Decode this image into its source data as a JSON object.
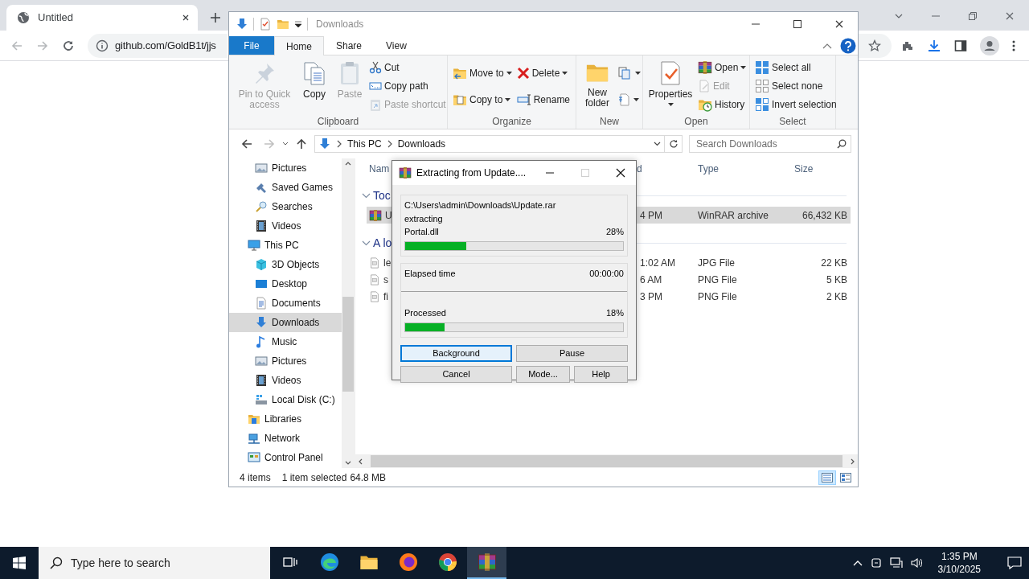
{
  "browser": {
    "tab_title": "Untitled",
    "url": "github.com/GoldB1t/jjs"
  },
  "explorer": {
    "title": "Downloads",
    "ribbon": {
      "tabs": [
        {
          "label": "File",
          "selected": false,
          "kind": "file"
        },
        {
          "label": "Home",
          "selected": true,
          "kind": "tab"
        },
        {
          "label": "Share",
          "selected": false,
          "kind": "tab"
        },
        {
          "label": "View",
          "selected": false,
          "kind": "tab"
        }
      ],
      "groups": [
        {
          "label": "Clipboard",
          "columns": [
            [
              {
                "kind": "large",
                "label": "Pin to Quick access",
                "disabled": true,
                "dropdown": false
              }
            ],
            [
              {
                "kind": "large",
                "label": "Copy",
                "disabled": false,
                "dropdown": false
              }
            ],
            [
              {
                "kind": "large",
                "label": "Paste",
                "disabled": true,
                "dropdown": false
              }
            ],
            [
              {
                "kind": "small",
                "label": "Cut",
                "disabled": false,
                "dropdown": false
              },
              {
                "kind": "small",
                "label": "Copy path",
                "disabled": false,
                "dropdown": false
              },
              {
                "kind": "small",
                "label": "Paste shortcut",
                "disabled": true,
                "dropdown": false
              }
            ]
          ]
        },
        {
          "label": "Organize",
          "columns": [
            [
              {
                "kind": "small",
                "label": "Move to",
                "disabled": false,
                "dropdown": true
              },
              {
                "kind": "small",
                "label": "Copy to",
                "disabled": false,
                "dropdown": true
              }
            ],
            [
              {
                "kind": "small",
                "label": "Delete",
                "disabled": false,
                "dropdown": true
              },
              {
                "kind": "small",
                "label": "Rename",
                "disabled": false,
                "dropdown": false
              }
            ]
          ]
        },
        {
          "label": "New",
          "columns": [
            [
              {
                "kind": "large",
                "label": "New folder",
                "disabled": false,
                "dropdown": false
              }
            ],
            [
              {
                "kind": "small",
                "disabled": false,
                "dropdown": true
              },
              {
                "kind": "small",
                "disabled": false,
                "dropdown": true
              }
            ]
          ]
        },
        {
          "label": "Open",
          "columns": [
            [
              {
                "kind": "large",
                "label": "Properties",
                "disabled": false,
                "dropdown": true
              }
            ],
            [
              {
                "kind": "small",
                "label": "Open",
                "disabled": false,
                "dropdown": true
              },
              {
                "kind": "small",
                "label": "Edit",
                "disabled": true,
                "dropdown": false
              },
              {
                "kind": "small",
                "label": "History",
                "disabled": false,
                "dropdown": false
              }
            ]
          ]
        },
        {
          "label": "Select",
          "columns": [
            [
              {
                "kind": "small",
                "label": "Select all",
                "disabled": false,
                "dropdown": false
              },
              {
                "kind": "small",
                "label": "Select none",
                "disabled": false,
                "dropdown": false
              },
              {
                "kind": "small",
                "label": "Invert selection",
                "disabled": false,
                "dropdown": false
              }
            ]
          ]
        }
      ]
    },
    "address": {
      "crumbs": [
        "This PC",
        "Downloads"
      ],
      "search_placeholder": "Search Downloads"
    },
    "nav_pane": {
      "items": [
        {
          "children": [
            {
              "label": "Pictures",
              "kind": "pictures",
              "selected": false
            },
            {
              "label": "Saved Games",
              "kind": "games",
              "selected": false
            },
            {
              "label": "Searches",
              "kind": "searches",
              "selected": false
            },
            {
              "label": "Videos",
              "kind": "videos",
              "selected": false
            }
          ]
        },
        {
          "label": "This PC",
          "kind": "pc",
          "selected": false,
          "children": [
            {
              "label": "3D Objects",
              "kind": "objects",
              "selected": false
            },
            {
              "label": "Desktop",
              "kind": "desktop",
              "selected": false
            },
            {
              "label": "Documents",
              "kind": "documents",
              "selected": false
            },
            {
              "label": "Downloads",
              "kind": "downloads",
              "selected": true
            },
            {
              "label": "Music",
              "kind": "music",
              "selected": false
            },
            {
              "label": "Pictures",
              "kind": "pictures",
              "selected": false
            },
            {
              "label": "Videos",
              "kind": "videos",
              "selected": false
            },
            {
              "label": "Local Disk (C:)",
              "kind": "drive",
              "selected": false
            }
          ]
        },
        {
          "label": "Libraries",
          "kind": "libraries",
          "selected": false
        },
        {
          "label": "Network",
          "kind": "network",
          "selected": false
        },
        {
          "label": "Control Panel",
          "kind": "control",
          "selected": false
        }
      ]
    },
    "file_list": {
      "columns": {
        "name": "Nam",
        "modified": "d",
        "type": "Type",
        "size": "Size"
      },
      "groups": [
        {
          "label": "Toc",
          "expanded": true,
          "rows": [
            {
              "name": "U",
              "modified": "4 PM",
              "type": "WinRAR archive",
              "size": "66,432 KB",
              "kind": "archive",
              "selected": true
            }
          ]
        },
        {
          "label": "A lo",
          "expanded": true,
          "rows": [
            {
              "name": "le",
              "modified": "1:02 AM",
              "type": "JPG File",
              "size": "22 KB",
              "kind": "file",
              "selected": false
            },
            {
              "name": "s",
              "modified": "6 AM",
              "type": "PNG File",
              "size": "5 KB",
              "kind": "file",
              "selected": false
            },
            {
              "name": "fi",
              "modified": "3 PM",
              "type": "PNG File",
              "size": "2 KB",
              "kind": "file",
              "selected": false
            }
          ]
        }
      ]
    },
    "status_bar": {
      "count": "4 items",
      "selection": "1 item selected",
      "size": "64.8 MB",
      "views": [
        {
          "kind": "details",
          "selected": true
        },
        {
          "kind": "tiles",
          "selected": false
        }
      ]
    }
  },
  "dialog": {
    "title": "Extracting from Update....",
    "archive_path": "C:\\Users\\admin\\Downloads\\Update.rar",
    "action": "extracting",
    "file": "Portal.dll",
    "file_percent": "28%",
    "file_progress": {
      "level": 0.28
    },
    "elapsed_label": "Elapsed time",
    "elapsed": "00:00:00",
    "processed_label": "Processed",
    "processed_percent": "18%",
    "processed_progress": {
      "level": 0.18
    },
    "maximize_disabled": true,
    "buttons": [
      {
        "label": "Background",
        "focused": true
      },
      {
        "label": "Pause",
        "focused": false
      },
      {
        "label": "Cancel",
        "focused": false
      },
      {
        "label": "Mode...",
        "focused": false
      },
      {
        "label": "Help",
        "focused": false
      }
    ]
  },
  "taskbar": {
    "search_placeholder": "Type here to search",
    "apps": [
      {
        "kind": "taskview",
        "active": false
      },
      {
        "kind": "edge",
        "active": false
      },
      {
        "kind": "explorer",
        "active": false
      },
      {
        "kind": "firefox",
        "active": false
      },
      {
        "kind": "chrome",
        "active": false
      },
      {
        "kind": "winrar",
        "active": true
      }
    ],
    "time": "1:35 PM",
    "date": "3/10/2025"
  }
}
